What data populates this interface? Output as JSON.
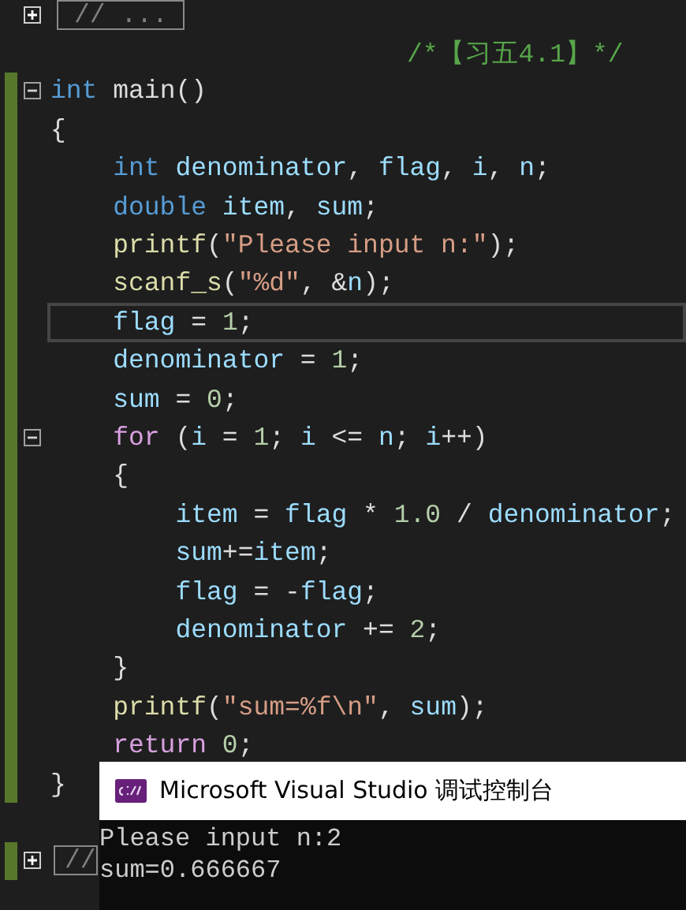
{
  "editor": {
    "lines": [
      {
        "kind": "collapsed",
        "changed": false,
        "current": false,
        "fold": {
          "expanded": false
        },
        "text": "// ..."
      },
      {
        "kind": "comment",
        "changed": false,
        "current": false,
        "text": "/*【习五4.1】*/"
      },
      {
        "kind": "code",
        "changed": true,
        "current": false,
        "fold": {
          "expanded": true
        },
        "tokens": [
          {
            "text": "int",
            "kind": "keyword"
          },
          {
            "text": " main()",
            "kind": "plain"
          }
        ]
      },
      {
        "kind": "code",
        "changed": true,
        "current": false,
        "tokens": [
          {
            "text": "{",
            "kind": "plain"
          }
        ]
      },
      {
        "kind": "code",
        "changed": true,
        "current": false,
        "tokens": [
          {
            "text": "    int",
            "kind": "keyword"
          },
          {
            "text": " denominator",
            "kind": "variable"
          },
          {
            "text": ", ",
            "kind": "plain"
          },
          {
            "text": "flag",
            "kind": "variable"
          },
          {
            "text": ", ",
            "kind": "plain"
          },
          {
            "text": "i",
            "kind": "variable"
          },
          {
            "text": ", ",
            "kind": "plain"
          },
          {
            "text": "n",
            "kind": "variable"
          },
          {
            "text": ";",
            "kind": "plain"
          }
        ]
      },
      {
        "kind": "code",
        "changed": true,
        "current": false,
        "tokens": [
          {
            "text": "    double",
            "kind": "keyword"
          },
          {
            "text": " item",
            "kind": "variable"
          },
          {
            "text": ", ",
            "kind": "plain"
          },
          {
            "text": "sum",
            "kind": "variable"
          },
          {
            "text": ";",
            "kind": "plain"
          }
        ]
      },
      {
        "kind": "code",
        "changed": true,
        "current": false,
        "tokens": [
          {
            "text": "    printf",
            "kind": "function"
          },
          {
            "text": "(",
            "kind": "plain"
          },
          {
            "text": "\"Please input n:\"",
            "kind": "string"
          },
          {
            "text": ");",
            "kind": "plain"
          }
        ]
      },
      {
        "kind": "code",
        "changed": true,
        "current": false,
        "tokens": [
          {
            "text": "    scanf_s",
            "kind": "function"
          },
          {
            "text": "(",
            "kind": "plain"
          },
          {
            "text": "\"%d\"",
            "kind": "string"
          },
          {
            "text": ", &",
            "kind": "plain"
          },
          {
            "text": "n",
            "kind": "variable"
          },
          {
            "text": ");",
            "kind": "plain"
          }
        ]
      },
      {
        "kind": "code",
        "changed": true,
        "current": true,
        "tokens": [
          {
            "text": "    flag",
            "kind": "variable"
          },
          {
            "text": " = ",
            "kind": "plain"
          },
          {
            "text": "1",
            "kind": "number"
          },
          {
            "text": ";",
            "kind": "plain"
          }
        ]
      },
      {
        "kind": "code",
        "changed": true,
        "current": false,
        "tokens": [
          {
            "text": "    denominator",
            "kind": "variable"
          },
          {
            "text": " = ",
            "kind": "plain"
          },
          {
            "text": "1",
            "kind": "number"
          },
          {
            "text": ";",
            "kind": "plain"
          }
        ]
      },
      {
        "kind": "code",
        "changed": true,
        "current": false,
        "tokens": [
          {
            "text": "    sum",
            "kind": "variable"
          },
          {
            "text": " = ",
            "kind": "plain"
          },
          {
            "text": "0",
            "kind": "number"
          },
          {
            "text": ";",
            "kind": "plain"
          }
        ]
      },
      {
        "kind": "code",
        "changed": true,
        "current": false,
        "fold": {
          "expanded": true
        },
        "tokens": [
          {
            "text": "    for",
            "kind": "control"
          },
          {
            "text": " (",
            "kind": "plain"
          },
          {
            "text": "i",
            "kind": "variable"
          },
          {
            "text": " = ",
            "kind": "plain"
          },
          {
            "text": "1",
            "kind": "number"
          },
          {
            "text": "; ",
            "kind": "plain"
          },
          {
            "text": "i",
            "kind": "variable"
          },
          {
            "text": " <= ",
            "kind": "plain"
          },
          {
            "text": "n",
            "kind": "variable"
          },
          {
            "text": "; ",
            "kind": "plain"
          },
          {
            "text": "i",
            "kind": "variable"
          },
          {
            "text": "++)",
            "kind": "plain"
          }
        ]
      },
      {
        "kind": "code",
        "changed": true,
        "current": false,
        "tokens": [
          {
            "text": "    {",
            "kind": "plain"
          }
        ]
      },
      {
        "kind": "code",
        "changed": true,
        "current": false,
        "tokens": [
          {
            "text": "        item",
            "kind": "variable"
          },
          {
            "text": " = ",
            "kind": "plain"
          },
          {
            "text": "flag",
            "kind": "variable"
          },
          {
            "text": " * ",
            "kind": "plain"
          },
          {
            "text": "1.0",
            "kind": "number"
          },
          {
            "text": " / ",
            "kind": "plain"
          },
          {
            "text": "denominator",
            "kind": "variable"
          },
          {
            "text": ";",
            "kind": "plain"
          }
        ]
      },
      {
        "kind": "code",
        "changed": true,
        "current": false,
        "tokens": [
          {
            "text": "        sum",
            "kind": "variable"
          },
          {
            "text": "+=",
            "kind": "plain"
          },
          {
            "text": "item",
            "kind": "variable"
          },
          {
            "text": ";",
            "kind": "plain"
          }
        ]
      },
      {
        "kind": "code",
        "changed": true,
        "current": false,
        "tokens": [
          {
            "text": "        flag",
            "kind": "variable"
          },
          {
            "text": " = -",
            "kind": "plain"
          },
          {
            "text": "flag",
            "kind": "variable"
          },
          {
            "text": ";",
            "kind": "plain"
          }
        ]
      },
      {
        "kind": "code",
        "changed": true,
        "current": false,
        "tokens": [
          {
            "text": "        denominator",
            "kind": "variable"
          },
          {
            "text": " += ",
            "kind": "plain"
          },
          {
            "text": "2",
            "kind": "number"
          },
          {
            "text": ";",
            "kind": "plain"
          }
        ]
      },
      {
        "kind": "code",
        "changed": true,
        "current": false,
        "tokens": [
          {
            "text": "    }",
            "kind": "plain"
          }
        ]
      },
      {
        "kind": "code",
        "changed": true,
        "current": false,
        "tokens": [
          {
            "text": "    printf",
            "kind": "function"
          },
          {
            "text": "(",
            "kind": "plain"
          },
          {
            "text": "\"sum=%f\\n\"",
            "kind": "string"
          },
          {
            "text": ", ",
            "kind": "plain"
          },
          {
            "text": "sum",
            "kind": "variable"
          },
          {
            "text": ");",
            "kind": "plain"
          }
        ]
      },
      {
        "kind": "code",
        "changed": true,
        "current": false,
        "tokens": [
          {
            "text": "    return",
            "kind": "control"
          },
          {
            "text": " 0",
            "kind": "number"
          },
          {
            "text": ";",
            "kind": "plain"
          }
        ]
      },
      {
        "kind": "code",
        "changed": true,
        "current": false,
        "tokens": [
          {
            "text": "}",
            "kind": "plain"
          }
        ]
      },
      {
        "kind": "blank",
        "changed": false,
        "current": false
      },
      {
        "kind": "collapsed",
        "changed": true,
        "current": false,
        "fold": {
          "expanded": false
        },
        "text": "//"
      }
    ]
  },
  "console": {
    "title": "Microsoft Visual Studio 调试控制台",
    "output": [
      "Please input n:2",
      "sum=0.666667"
    ]
  }
}
